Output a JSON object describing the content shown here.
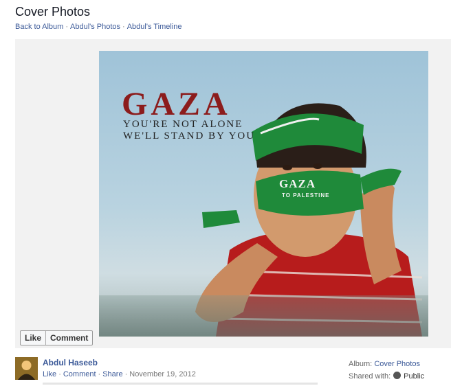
{
  "header": {
    "title": "Cover Photos"
  },
  "breadcrumbs": [
    {
      "label": "Back to Album"
    },
    {
      "label": "Abdul's Photos"
    },
    {
      "label": "Abdul's Timeline"
    }
  ],
  "photo": {
    "headline": "GAZA",
    "line1": "YOU'RE NOT ALONE",
    "line2": "WE'LL STAND BY YOU",
    "scarf_text": "GAZA",
    "scarf_subtext": "TO PALESTINE"
  },
  "actions_bar": {
    "like": "Like",
    "comment": "Comment"
  },
  "owner": {
    "name": "Abdul Haseeb"
  },
  "post_actions": {
    "like": "Like",
    "comment": "Comment",
    "share": "Share",
    "date": "November 19, 2012"
  },
  "meta": {
    "album_label": "Album:",
    "album_name": "Cover Photos",
    "shared_label": "Shared with:",
    "privacy": "Public"
  },
  "colors": {
    "link": "#3b5998",
    "accent_red": "#8c1c1c",
    "scarf_green": "#1f8a3a"
  }
}
